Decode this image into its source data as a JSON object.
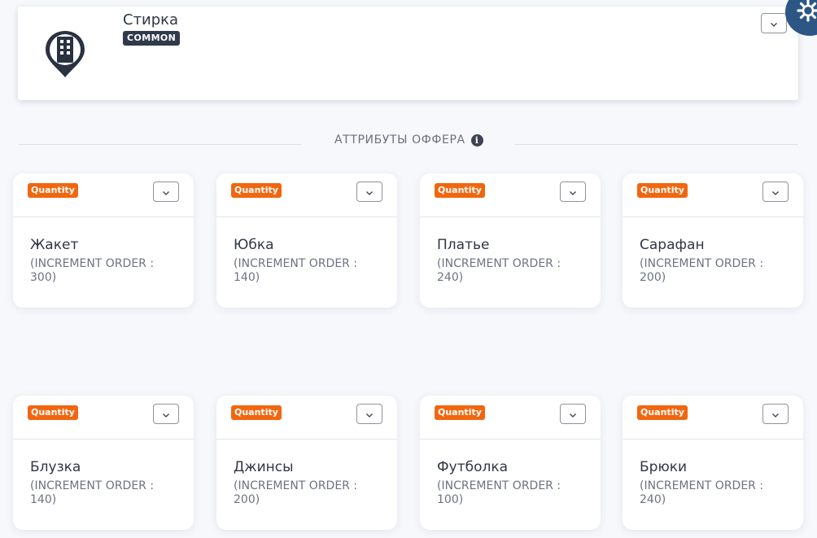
{
  "header": {
    "title": "Стирка",
    "badge": "COMMON",
    "icon": "building-pin-icon"
  },
  "section": {
    "title": "АТТРИБУТЫ ОФФЕРА",
    "info_icon": "i"
  },
  "colors": {
    "badge_orange": "#f2660f",
    "badge_dark": "#2f3a4b",
    "gear_blue": "#2c5683"
  },
  "cards": [
    {
      "badge": "Quantity",
      "name": "Жакет",
      "inc_line1": "(INCREMENT ORDER :",
      "inc_line2": "300)"
    },
    {
      "badge": "Quantity",
      "name": "Юбка",
      "inc_line1": "(INCREMENT ORDER :",
      "inc_line2": "140)"
    },
    {
      "badge": "Quantity",
      "name": "Платье",
      "inc_line1": "(INCREMENT ORDER :",
      "inc_line2": "240)"
    },
    {
      "badge": "Quantity",
      "name": "Сарафан",
      "inc_line1": "(INCREMENT ORDER :",
      "inc_line2": "200)"
    },
    {
      "badge": "Quantity",
      "name": "Блузка",
      "inc_line1": "(INCREMENT ORDER :",
      "inc_line2": "140)"
    },
    {
      "badge": "Quantity",
      "name": "Джинсы",
      "inc_line1": "(INCREMENT ORDER :",
      "inc_line2": "200)"
    },
    {
      "badge": "Quantity",
      "name": "Футболка",
      "inc_line1": "(INCREMENT ORDER :",
      "inc_line2": "100)"
    },
    {
      "badge": "Quantity",
      "name": "Брюки",
      "inc_line1": "(INCREMENT ORDER :",
      "inc_line2": "240)"
    }
  ]
}
